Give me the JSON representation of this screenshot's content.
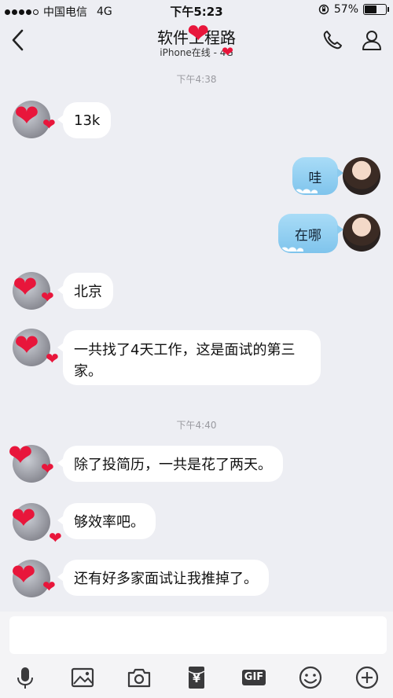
{
  "status": {
    "carrier": "中国电信",
    "network": "4G",
    "time": "下午5:23",
    "battery": "57%",
    "battery_level": 0.57
  },
  "header": {
    "title": "软件工程路",
    "subtitle": "iPhone在线 - 4G"
  },
  "messages": {
    "ts1": "下午4:38",
    "ts2": "下午4:40",
    "m1": "13k",
    "m2": "哇",
    "m3": "在哪",
    "m4": "北京",
    "m5_line1": "一共找了4天工作，这是面试的第三",
    "m5_line2": "家。",
    "m6": "除了投简历，一共是花了两天。",
    "m7": "够效率吧。",
    "m8": "还有好多家面试让我推掉了。"
  },
  "input": {
    "placeholder": ""
  },
  "toolbar": {
    "icons": [
      "mic-icon",
      "image-icon",
      "camera-icon",
      "red-packet-icon",
      "gif-icon",
      "emoji-icon",
      "plus-icon"
    ],
    "gif_label": "GIF",
    "yuan_label": "¥"
  }
}
